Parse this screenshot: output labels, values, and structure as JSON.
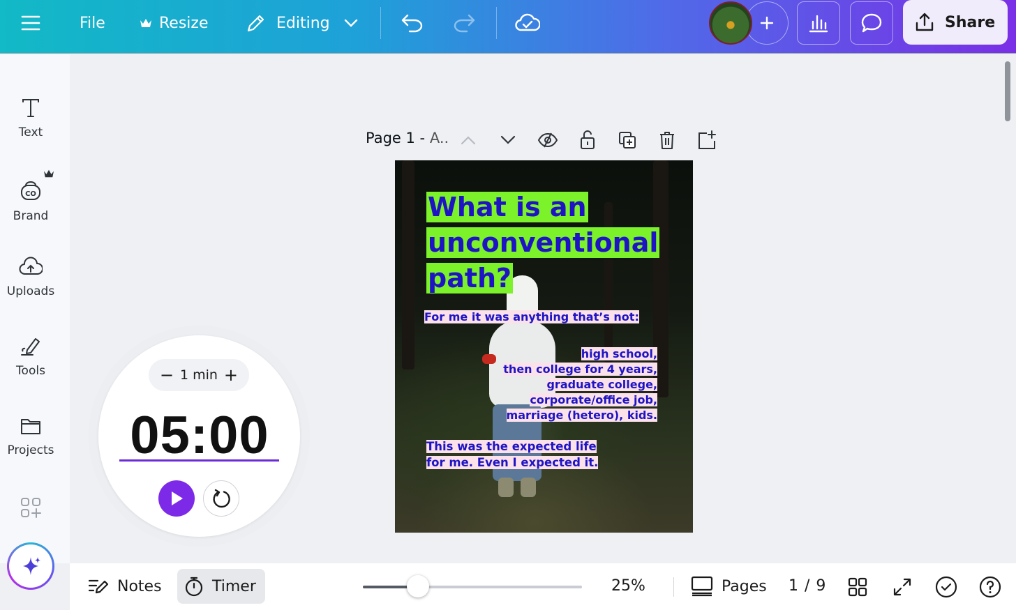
{
  "topbar": {
    "file_label": "File",
    "resize_label": "Resize",
    "editing_label": "Editing",
    "share_label": "Share"
  },
  "sidebar": {
    "items": [
      {
        "label": "Text",
        "icon": "text-icon"
      },
      {
        "label": "Brand",
        "icon": "brand-icon"
      },
      {
        "label": "Uploads",
        "icon": "cloud-upload-icon"
      },
      {
        "label": "Tools",
        "icon": "pen-tool-icon"
      },
      {
        "label": "Projects",
        "icon": "folder-icon"
      }
    ]
  },
  "page_toolbar": {
    "title": "Page 1 -",
    "title_suffix": "A.."
  },
  "design": {
    "headline_lines": [
      "What is an",
      "unconventional",
      "path?"
    ],
    "intro": "For me it was anything that’s not:",
    "list_lines": [
      "high school,",
      "then college for 4 years,",
      "graduate college,",
      "corporate/office job,",
      "marriage (hetero), kids."
    ],
    "closing_lines": [
      "This was the expected life",
      "for me. Even I expected it."
    ],
    "colors": {
      "highlight_green": "#7cf22a",
      "highlight_pink": "#fbe1ea",
      "text_blue": "#1e14c4"
    }
  },
  "timer": {
    "duration": "1 min",
    "minus": "−",
    "plus": "+",
    "time": "05:00",
    "accent": "#7d2ae8"
  },
  "bottombar": {
    "notes_label": "Notes",
    "timer_label": "Timer",
    "zoom": "25%",
    "zoom_fraction": 0.25,
    "pages_label": "Pages",
    "page_count": "1 / 9"
  }
}
